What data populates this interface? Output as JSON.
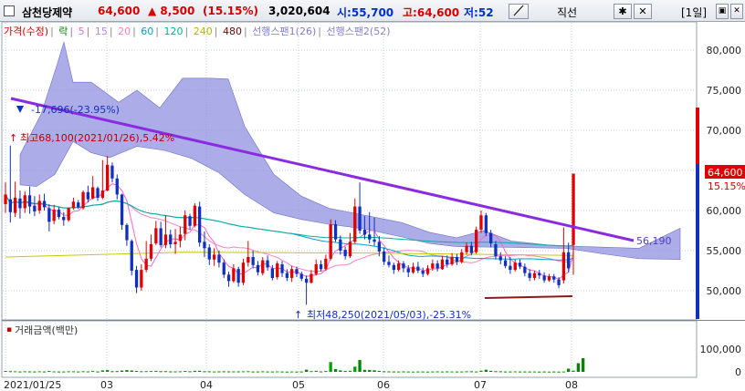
{
  "header": {
    "stock_name": "삼천당제약",
    "price": "64,600",
    "change": "▲ 8,500",
    "change_pct": "(15.15%)",
    "volume": "3,020,604",
    "open": "시:55,700",
    "high": "고:64,600",
    "low": "저:52",
    "tool_label": "직선",
    "period": "[1일]"
  },
  "legend": {
    "items": [
      {
        "text": "가격(수정)",
        "color": "#d40000"
      },
      {
        "text": "락",
        "color": "#008000"
      },
      {
        "text": "5",
        "color": "#ff66cc"
      },
      {
        "text": "15",
        "color": "#c080ff"
      },
      {
        "text": "20",
        "color": "#ff80c0"
      },
      {
        "text": "60",
        "color": "#00a0c8"
      },
      {
        "text": "120",
        "color": "#00b0a0"
      },
      {
        "text": "240",
        "color": "#c8c800"
      },
      {
        "text": "480",
        "color": "#800000"
      },
      {
        "text": "선행스팬1(26)",
        "color": "#9090d0"
      },
      {
        "text": "선행스팬2(52)",
        "color": "#9090d0"
      }
    ]
  },
  "annotations": {
    "drop": "-17,696(-23.95%)",
    "high": "최고68,100(2021/01/26),5.42%",
    "low": "최저48,250(2021/05/03),-25.31%",
    "trendline_value": "56,190",
    "current_price": "64,600",
    "current_pct": "15.15%"
  },
  "volume_panel": {
    "title": "거래금액(백만)"
  },
  "colors": {
    "up": "#e00000",
    "down": "#1030c0",
    "cloud": "#9090e0",
    "trendline": "#8a2be2"
  },
  "chart_data": {
    "type": "candlestick",
    "price_axis_ticks": [
      "80,000",
      "75,000",
      "70,000",
      "65,000",
      "60,000",
      "55,000",
      "50,000"
    ],
    "volume_axis_ticks": [
      "100,000",
      "0"
    ],
    "x_ticks": [
      "2021/01/25",
      "03",
      "04",
      "05",
      "06",
      "07",
      "08"
    ],
    "ylim": [
      46000,
      83000
    ],
    "candles": [
      {
        "o": 60800,
        "c": 62000,
        "h": 63500,
        "l": 59700
      },
      {
        "o": 61400,
        "c": 59800,
        "h": 68100,
        "l": 58500
      },
      {
        "o": 59700,
        "c": 61600,
        "h": 63600,
        "l": 59200
      },
      {
        "o": 61500,
        "c": 60300,
        "h": 62500,
        "l": 59000
      },
      {
        "o": 60300,
        "c": 61900,
        "h": 62400,
        "l": 59700
      },
      {
        "o": 61900,
        "c": 60500,
        "h": 63000,
        "l": 59600
      },
      {
        "o": 60600,
        "c": 59900,
        "h": 61800,
        "l": 59300
      },
      {
        "o": 60000,
        "c": 61200,
        "h": 62000,
        "l": 59600
      },
      {
        "o": 61200,
        "c": 60400,
        "h": 62100,
        "l": 60000
      },
      {
        "o": 60300,
        "c": 58600,
        "h": 60800,
        "l": 57400
      },
      {
        "o": 58700,
        "c": 60100,
        "h": 60700,
        "l": 58300
      },
      {
        "o": 60100,
        "c": 59200,
        "h": 60400,
        "l": 58900
      },
      {
        "o": 59200,
        "c": 58800,
        "h": 59800,
        "l": 58100
      },
      {
        "o": 58800,
        "c": 60300,
        "h": 60400,
        "l": 58600
      },
      {
        "o": 60300,
        "c": 61100,
        "h": 61600,
        "l": 60100
      },
      {
        "o": 61000,
        "c": 60400,
        "h": 61300,
        "l": 60200
      },
      {
        "o": 60300,
        "c": 62300,
        "h": 62500,
        "l": 60100
      },
      {
        "o": 62300,
        "c": 61400,
        "h": 63100,
        "l": 61000
      },
      {
        "o": 61500,
        "c": 62900,
        "h": 64300,
        "l": 61400
      },
      {
        "o": 62800,
        "c": 61600,
        "h": 63000,
        "l": 61200
      },
      {
        "o": 61600,
        "c": 62500,
        "h": 66300,
        "l": 61400
      },
      {
        "o": 62500,
        "c": 65700,
        "h": 66800,
        "l": 62400
      },
      {
        "o": 65600,
        "c": 64000,
        "h": 66000,
        "l": 63500
      },
      {
        "o": 64000,
        "c": 62000,
        "h": 64500,
        "l": 61400
      },
      {
        "o": 62000,
        "c": 58200,
        "h": 62100,
        "l": 57600
      },
      {
        "o": 58200,
        "c": 56300,
        "h": 58400,
        "l": 55600
      },
      {
        "o": 56200,
        "c": 52500,
        "h": 56400,
        "l": 51900
      },
      {
        "o": 52600,
        "c": 50400,
        "h": 53100,
        "l": 49700
      },
      {
        "o": 50400,
        "c": 52600,
        "h": 53300,
        "l": 50000
      },
      {
        "o": 52600,
        "c": 54000,
        "h": 56200,
        "l": 52300
      },
      {
        "o": 54000,
        "c": 55800,
        "h": 57000,
        "l": 53700
      },
      {
        "o": 55900,
        "c": 57800,
        "h": 58700,
        "l": 55700
      },
      {
        "o": 57800,
        "c": 55700,
        "h": 58600,
        "l": 55400
      },
      {
        "o": 55700,
        "c": 57000,
        "h": 59400,
        "l": 55300
      },
      {
        "o": 57000,
        "c": 55800,
        "h": 57600,
        "l": 55300
      },
      {
        "o": 55800,
        "c": 56100,
        "h": 57700,
        "l": 54600
      },
      {
        "o": 56200,
        "c": 57000,
        "h": 58000,
        "l": 55400
      },
      {
        "o": 57100,
        "c": 59400,
        "h": 60000,
        "l": 56300
      },
      {
        "o": 59300,
        "c": 58100,
        "h": 59600,
        "l": 57600
      },
      {
        "o": 58100,
        "c": 60600,
        "h": 60900,
        "l": 57900
      },
      {
        "o": 60500,
        "c": 56000,
        "h": 61100,
        "l": 55500
      },
      {
        "o": 56100,
        "c": 55300,
        "h": 57400,
        "l": 54200
      },
      {
        "o": 55400,
        "c": 53900,
        "h": 55800,
        "l": 53200
      },
      {
        "o": 53900,
        "c": 54500,
        "h": 55300,
        "l": 53100
      },
      {
        "o": 54500,
        "c": 53500,
        "h": 55000,
        "l": 52900
      },
      {
        "o": 53500,
        "c": 52000,
        "h": 53900,
        "l": 51600
      },
      {
        "o": 52000,
        "c": 51200,
        "h": 52400,
        "l": 50500
      },
      {
        "o": 51200,
        "c": 52800,
        "h": 53300,
        "l": 51000
      },
      {
        "o": 52700,
        "c": 51000,
        "h": 53000,
        "l": 50500
      },
      {
        "o": 51000,
        "c": 53500,
        "h": 54000,
        "l": 50700
      },
      {
        "o": 53500,
        "c": 54200,
        "h": 56200,
        "l": 53000
      },
      {
        "o": 54200,
        "c": 53200,
        "h": 55000,
        "l": 52800
      },
      {
        "o": 53200,
        "c": 52300,
        "h": 53700,
        "l": 51900
      },
      {
        "o": 52200,
        "c": 53800,
        "h": 54200,
        "l": 51900
      },
      {
        "o": 53800,
        "c": 52900,
        "h": 54400,
        "l": 52500
      },
      {
        "o": 52800,
        "c": 51600,
        "h": 53200,
        "l": 51300
      },
      {
        "o": 51700,
        "c": 53400,
        "h": 53700,
        "l": 51400
      },
      {
        "o": 53300,
        "c": 52200,
        "h": 53700,
        "l": 51700
      },
      {
        "o": 52200,
        "c": 51600,
        "h": 52700,
        "l": 51200
      },
      {
        "o": 51600,
        "c": 52700,
        "h": 53100,
        "l": 51100
      },
      {
        "o": 52700,
        "c": 52100,
        "h": 53000,
        "l": 51700
      },
      {
        "o": 52100,
        "c": 51500,
        "h": 52400,
        "l": 51200
      },
      {
        "o": 51500,
        "c": 51000,
        "h": 51900,
        "l": 48250
      },
      {
        "o": 51000,
        "c": 52100,
        "h": 52600,
        "l": 50900
      },
      {
        "o": 52100,
        "c": 53300,
        "h": 53900,
        "l": 51900
      },
      {
        "o": 53300,
        "c": 52700,
        "h": 53800,
        "l": 52400
      },
      {
        "o": 52700,
        "c": 54000,
        "h": 54500,
        "l": 52500
      },
      {
        "o": 54000,
        "c": 58300,
        "h": 58900,
        "l": 53800
      },
      {
        "o": 58300,
        "c": 56400,
        "h": 58800,
        "l": 56100
      },
      {
        "o": 56400,
        "c": 55000,
        "h": 56900,
        "l": 54500
      },
      {
        "o": 55100,
        "c": 54300,
        "h": 55500,
        "l": 53900
      },
      {
        "o": 54300,
        "c": 56100,
        "h": 57200,
        "l": 54100
      },
      {
        "o": 56100,
        "c": 60500,
        "h": 61500,
        "l": 55900
      },
      {
        "o": 60500,
        "c": 57500,
        "h": 63500,
        "l": 57100
      },
      {
        "o": 57600,
        "c": 57000,
        "h": 59300,
        "l": 56400
      },
      {
        "o": 57000,
        "c": 56400,
        "h": 59800,
        "l": 55900
      },
      {
        "o": 56400,
        "c": 56100,
        "h": 59100,
        "l": 55600
      },
      {
        "o": 56100,
        "c": 54900,
        "h": 56800,
        "l": 54300
      },
      {
        "o": 54900,
        "c": 53600,
        "h": 55400,
        "l": 53200
      },
      {
        "o": 53600,
        "c": 53200,
        "h": 54400,
        "l": 52900
      },
      {
        "o": 53200,
        "c": 52600,
        "h": 53500,
        "l": 52100
      },
      {
        "o": 52600,
        "c": 53400,
        "h": 53800,
        "l": 52400
      },
      {
        "o": 53400,
        "c": 52800,
        "h": 53700,
        "l": 52300
      },
      {
        "o": 52800,
        "c": 52300,
        "h": 53200,
        "l": 51700
      },
      {
        "o": 52300,
        "c": 53000,
        "h": 53500,
        "l": 52100
      },
      {
        "o": 53000,
        "c": 52500,
        "h": 53600,
        "l": 52200
      },
      {
        "o": 52500,
        "c": 52100,
        "h": 52900,
        "l": 51700
      },
      {
        "o": 52100,
        "c": 52800,
        "h": 53200,
        "l": 51900
      },
      {
        "o": 52800,
        "c": 53400,
        "h": 53900,
        "l": 52500
      },
      {
        "o": 53400,
        "c": 52800,
        "h": 53800,
        "l": 52400
      },
      {
        "o": 52700,
        "c": 53900,
        "h": 54300,
        "l": 52600
      },
      {
        "o": 53900,
        "c": 53300,
        "h": 54400,
        "l": 52900
      },
      {
        "o": 53300,
        "c": 54200,
        "h": 54700,
        "l": 53100
      },
      {
        "o": 54200,
        "c": 53600,
        "h": 54600,
        "l": 53200
      },
      {
        "o": 53600,
        "c": 54800,
        "h": 55200,
        "l": 53400
      },
      {
        "o": 54800,
        "c": 55600,
        "h": 56000,
        "l": 54500
      },
      {
        "o": 55600,
        "c": 54700,
        "h": 56100,
        "l": 54400
      },
      {
        "o": 54800,
        "c": 57600,
        "h": 58000,
        "l": 54600
      },
      {
        "o": 57600,
        "c": 59400,
        "h": 60000,
        "l": 57200
      },
      {
        "o": 59400,
        "c": 57200,
        "h": 59700,
        "l": 56800
      },
      {
        "o": 57200,
        "c": 55900,
        "h": 57600,
        "l": 55400
      },
      {
        "o": 55800,
        "c": 54300,
        "h": 56200,
        "l": 53900
      },
      {
        "o": 54300,
        "c": 53800,
        "h": 54800,
        "l": 53300
      },
      {
        "o": 53800,
        "c": 53100,
        "h": 54300,
        "l": 52800
      },
      {
        "o": 53100,
        "c": 52600,
        "h": 54200,
        "l": 52100
      },
      {
        "o": 52600,
        "c": 53500,
        "h": 53900,
        "l": 52400
      },
      {
        "o": 53500,
        "c": 53000,
        "h": 53900,
        "l": 52700
      },
      {
        "o": 53000,
        "c": 52200,
        "h": 53400,
        "l": 51800
      },
      {
        "o": 52200,
        "c": 51600,
        "h": 52700,
        "l": 51200
      },
      {
        "o": 51600,
        "c": 52200,
        "h": 52500,
        "l": 51300
      },
      {
        "o": 52200,
        "c": 51900,
        "h": 52600,
        "l": 51500
      },
      {
        "o": 51900,
        "c": 51300,
        "h": 52300,
        "l": 51000
      },
      {
        "o": 51300,
        "c": 51800,
        "h": 52100,
        "l": 51100
      },
      {
        "o": 51800,
        "c": 51400,
        "h": 52100,
        "l": 51000
      },
      {
        "o": 51400,
        "c": 50700,
        "h": 51700,
        "l": 50300
      },
      {
        "o": 51300,
        "c": 54800,
        "h": 57900,
        "l": 50900
      },
      {
        "o": 54800,
        "c": 52800,
        "h": 56000,
        "l": 52300
      },
      {
        "o": 55700,
        "c": 64600,
        "h": 64600,
        "l": 52000
      }
    ],
    "volumes": [
      4000,
      2800,
      2200,
      1800,
      2300,
      1900,
      1700,
      2600,
      1600,
      3800,
      2100,
      1800,
      1500,
      2400,
      2200,
      1500,
      3000,
      2000,
      3400,
      1800,
      6200,
      8500,
      2800,
      3200,
      5600,
      7400,
      6100,
      3900,
      2700,
      3100,
      3600,
      4400,
      2900,
      3300,
      2100,
      2000,
      2500,
      4100,
      2300,
      5000,
      4900,
      2600,
      2200,
      1800,
      1900,
      2400,
      2100,
      2000,
      1900,
      2400,
      2800,
      1700,
      1600,
      2300,
      1500,
      1700,
      1900,
      1500,
      1300,
      1800,
      1200,
      1400,
      9800,
      3300,
      4200,
      2000,
      3600,
      43000,
      12000,
      6500,
      3600,
      4800,
      23000,
      52000,
      9000,
      8200,
      6700,
      3900,
      2600,
      2000,
      1700,
      1500,
      1900,
      1400,
      1300,
      1700,
      1500,
      1300,
      1600,
      2100,
      1500,
      1900,
      1400,
      1800,
      1500,
      2300,
      2600,
      1600,
      5100,
      9200,
      4300,
      2800,
      2300,
      1800,
      1600,
      2000,
      1700,
      1500,
      1700,
      1400,
      1300,
      1500,
      1200,
      1400,
      1300,
      1600,
      14000,
      5200,
      38000,
      60000
    ]
  }
}
